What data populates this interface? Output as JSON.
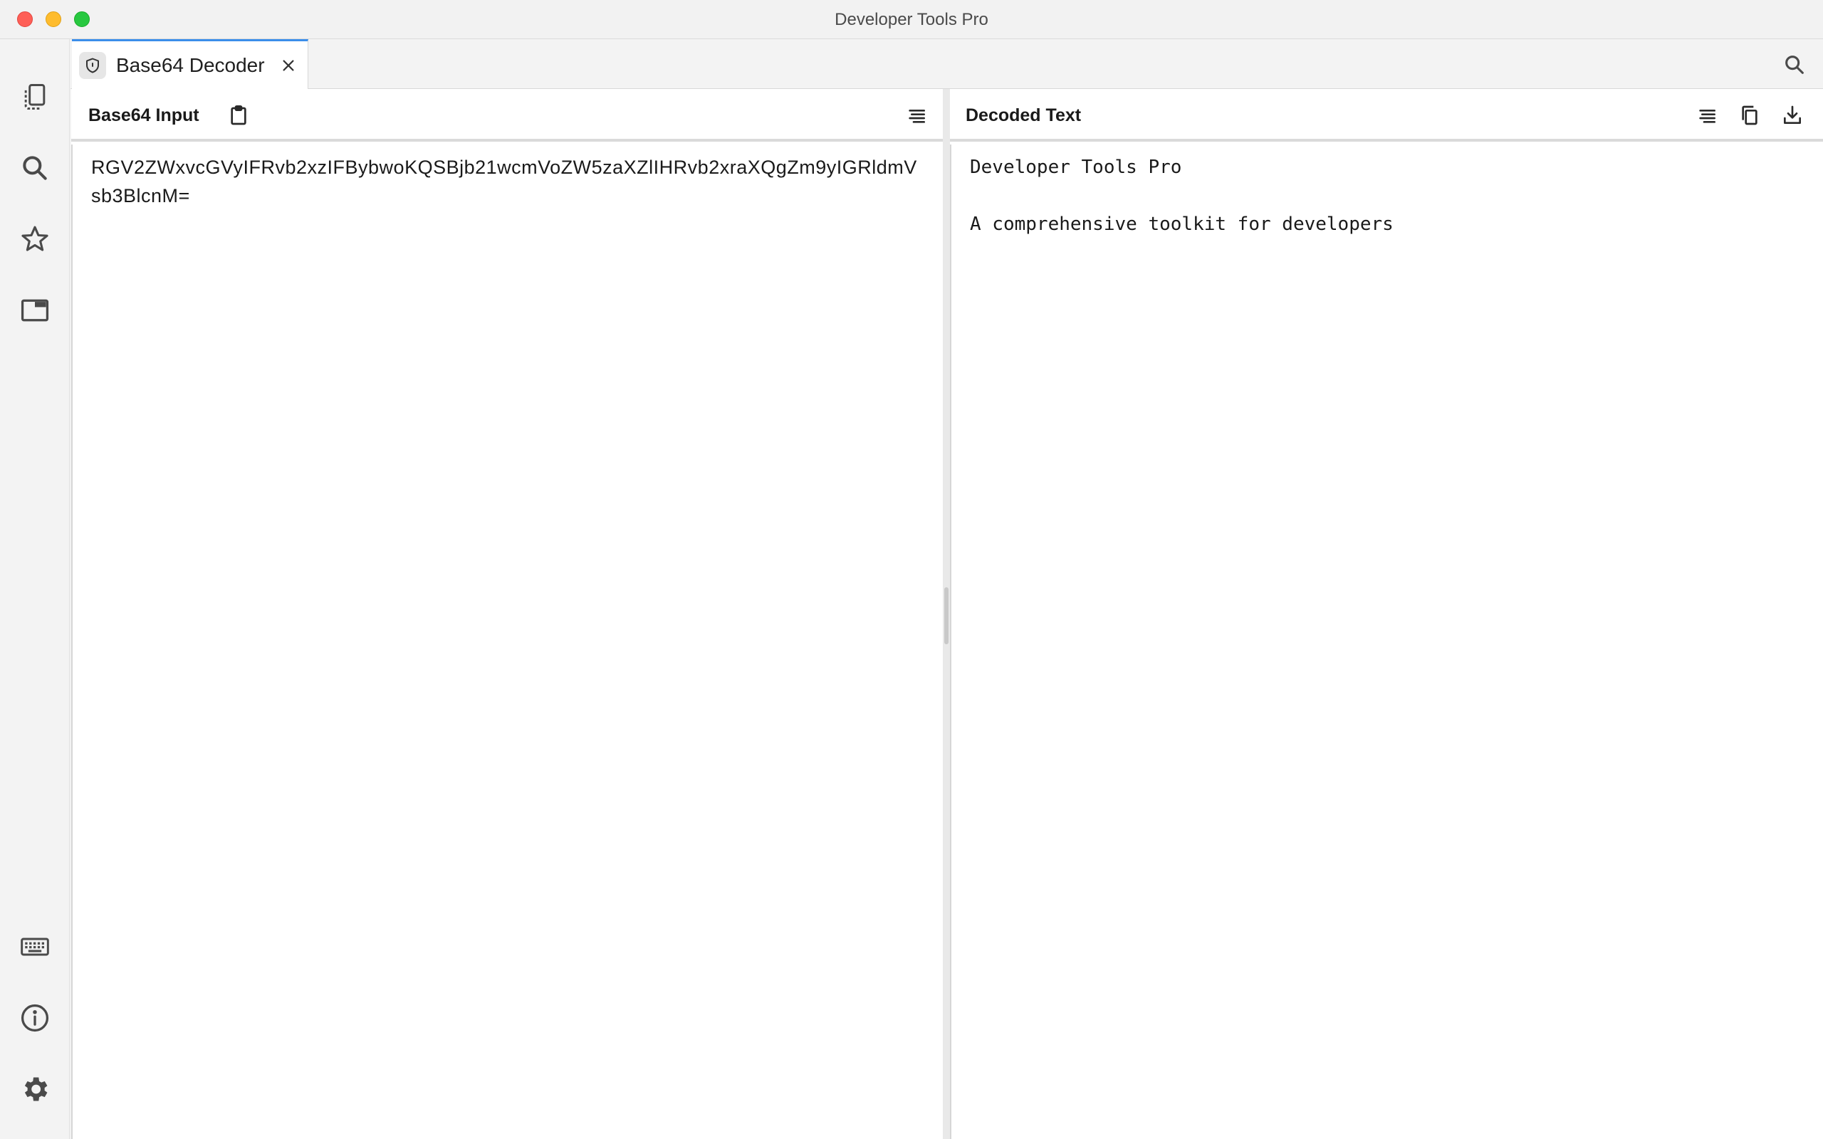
{
  "window": {
    "title": "Developer Tools Pro"
  },
  "activity_bar": {
    "top_items": [
      {
        "name": "tools",
        "icon": "copy-pages-icon"
      },
      {
        "name": "search",
        "icon": "search-icon"
      },
      {
        "name": "favorites",
        "icon": "star-icon"
      },
      {
        "name": "windows",
        "icon": "window-icon"
      }
    ],
    "bottom_items": [
      {
        "name": "shortcuts",
        "icon": "keyboard-icon"
      },
      {
        "name": "about",
        "icon": "info-icon"
      },
      {
        "name": "settings",
        "icon": "gear-icon"
      }
    ]
  },
  "tabs": [
    {
      "label": "Base64 Decoder",
      "icon": "shield-icon",
      "active": true
    }
  ],
  "input_panel": {
    "title": "Base64 Input",
    "value": "RGV2ZWxvcGVyIFRvb2xzIFBybwoKQSBjb21wcmVoZW5zaXZlIHRvb2xraXQgZm9yIGRldmVsb3BlcnM="
  },
  "output_panel": {
    "title": "Decoded Text",
    "value": "Developer Tools Pro\n\nA comprehensive toolkit for developers"
  },
  "colors": {
    "accent": "#3b8eea",
    "close": "#fe5f57",
    "minimize": "#febc2e",
    "maximize": "#28c840"
  }
}
